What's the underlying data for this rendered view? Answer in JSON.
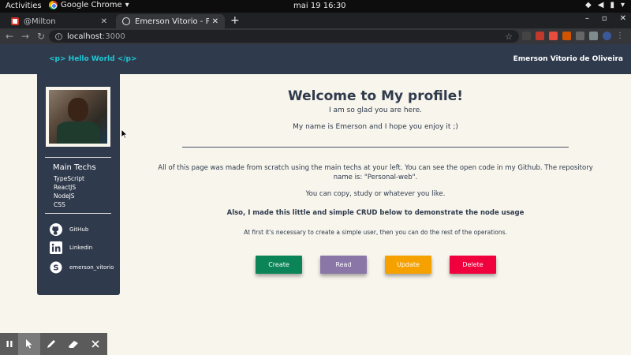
{
  "system_bar": {
    "activities": "Activities",
    "app_name": "Google Chrome",
    "clock": "mai 19  16:30"
  },
  "browser": {
    "tabs": [
      {
        "title": "@Milton"
      },
      {
        "title": "Emerson Vitorio - Personal"
      }
    ],
    "url_host": "localhost",
    "url_port": ":3000"
  },
  "site": {
    "logo": "<p> Hello World </p>",
    "owner_name": "Emerson Vitorio de Oliveira"
  },
  "sidebar": {
    "techs_title": "Main Techs",
    "techs": [
      "TypeScript",
      "ReactJS",
      "NodeJS",
      "CSS"
    ],
    "social": [
      {
        "label": "GitHub",
        "icon": "github-icon"
      },
      {
        "label": "Linkedin",
        "icon": "linkedin-icon"
      },
      {
        "label": "emerson_vitorio",
        "icon": "skype-icon"
      }
    ]
  },
  "main": {
    "title": "Welcome to My profile!",
    "subtitle": "I am so glad you are here.",
    "intro": "My name is Emerson and I hope you enjoy it ;)",
    "about": "All of this page was made from scratch using the main techs at your left. You can see the open code in my Github. The repository name is: \"Personal-web\".",
    "copy_note": "You can copy, study or whatever you like.",
    "crud_note": "Also, I made this little and simple CRUD below to demonstrate the node usage",
    "first_note": "At first it's necessary to create a simple user, then you can do the rest of the operations.",
    "buttons": [
      {
        "label": "Create",
        "color": "#0b8457"
      },
      {
        "label": "Read",
        "color": "#8b76a8"
      },
      {
        "label": "Update",
        "color": "#f5a100"
      },
      {
        "label": "Delete",
        "color": "#f0003c"
      }
    ]
  },
  "colors": {
    "header_bg": "#2f3a4c",
    "page_bg": "#f7f5ec",
    "logo_accent": "#1ec8d6"
  }
}
